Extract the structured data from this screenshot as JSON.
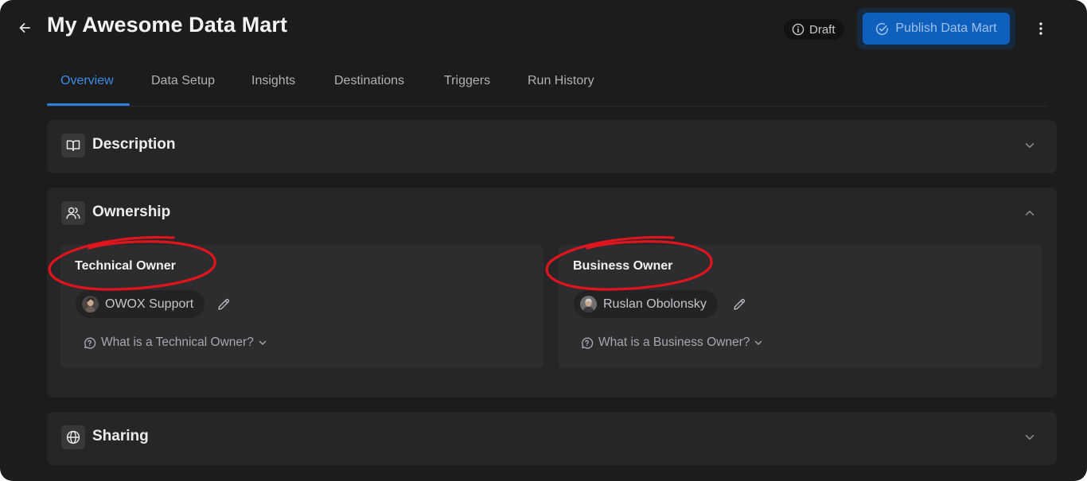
{
  "header": {
    "title": "My Awesome Data Mart",
    "status": "Draft",
    "publish_label": "Publish Data Mart",
    "icons": {
      "back": "arrow-left-icon",
      "status": "info-circle-icon",
      "publish": "check-circle-icon",
      "more": "kebab-menu-icon"
    }
  },
  "tabs": [
    {
      "label": "Overview",
      "active": true
    },
    {
      "label": "Data Setup",
      "active": false
    },
    {
      "label": "Insights",
      "active": false
    },
    {
      "label": "Destinations",
      "active": false
    },
    {
      "label": "Triggers",
      "active": false
    },
    {
      "label": "Run History",
      "active": false
    }
  ],
  "sections": {
    "description": {
      "title": "Description",
      "expanded": false,
      "icon": "book-open-icon"
    },
    "ownership": {
      "title": "Ownership",
      "expanded": true,
      "icon": "users-icon",
      "technical": {
        "label": "Technical Owner",
        "owner_name": "OWOX Support",
        "help": "What is a Technical Owner?"
      },
      "business": {
        "label": "Business Owner",
        "owner_name": "Ruslan Obolonsky",
        "help": "What is a Business Owner?"
      }
    },
    "sharing": {
      "title": "Sharing",
      "expanded": false,
      "icon": "globe-icon"
    }
  },
  "colors": {
    "background": "#1c1c1d",
    "card": "#262628",
    "accent": "#2f7fdc",
    "publish_button": "#0f5fbd",
    "highlight_ring": "#e0141c"
  }
}
